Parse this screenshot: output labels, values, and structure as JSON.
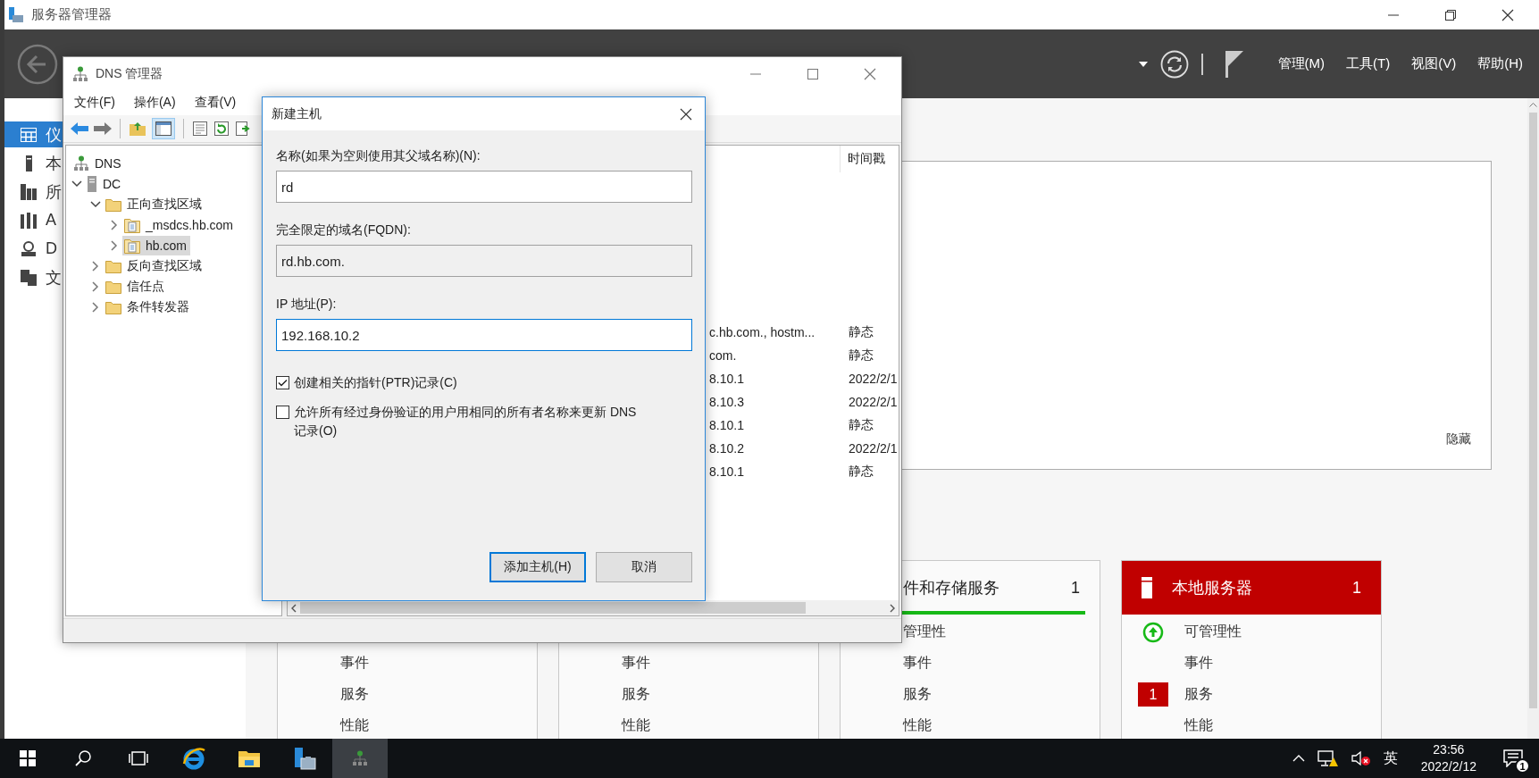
{
  "server_manager": {
    "title": "服务器管理器",
    "menu": [
      "管理(M)",
      "工具(T)",
      "视图(V)",
      "帮助(H)"
    ],
    "nav": [
      {
        "label": "仪",
        "kind": "dashboard",
        "selected": true
      },
      {
        "label": "本",
        "kind": "local",
        "selected": false
      },
      {
        "label": "所",
        "kind": "all",
        "selected": false
      },
      {
        "label": "A",
        "kind": "adds",
        "selected": false
      },
      {
        "label": "D",
        "kind": "dns",
        "selected": false
      },
      {
        "label": "文",
        "kind": "files",
        "selected": false
      }
    ],
    "panel": {
      "hide_link": "隐藏"
    },
    "tiles": [
      {
        "items": [
          {
            "label": "事件"
          },
          {
            "label": "服务"
          },
          {
            "label": "性能"
          }
        ]
      },
      {
        "items": [
          {
            "label": "事件"
          },
          {
            "label": "服务"
          },
          {
            "label": "性能"
          }
        ]
      },
      {
        "title": "件和存储服务",
        "count": "1",
        "alert": false,
        "items": [
          {
            "label": "管理性"
          },
          {
            "label": "事件"
          },
          {
            "label": "服务"
          },
          {
            "label": "性能"
          }
        ]
      },
      {
        "title": "本地服务器",
        "count": "1",
        "alert": true,
        "items": [
          {
            "label": "可管理性",
            "kind": "status_ok"
          },
          {
            "label": "事件"
          },
          {
            "label": "服务",
            "badge": "1"
          },
          {
            "label": "性能"
          }
        ]
      }
    ]
  },
  "dns_manager": {
    "title": "DNS 管理器",
    "menu": [
      "文件(F)",
      "操作(A)",
      "查看(V)"
    ],
    "tree": [
      {
        "label": "DNS",
        "kind": "dns_root",
        "selected": false,
        "children": [
          {
            "label": "DC",
            "kind": "server",
            "expanded": true,
            "selected": false,
            "children": [
              {
                "label": "正向查找区域",
                "kind": "folder",
                "expanded": true,
                "selected": false,
                "children": [
                  {
                    "label": "_msdcs.hb.com",
                    "kind": "zone",
                    "expanded": false,
                    "selected": false
                  },
                  {
                    "label": "hb.com",
                    "kind": "zone",
                    "expanded": false,
                    "selected": true
                  }
                ]
              },
              {
                "label": "反向查找区域",
                "kind": "folder",
                "expanded": false,
                "selected": false
              },
              {
                "label": "信任点",
                "kind": "folder",
                "expanded": false,
                "selected": false
              },
              {
                "label": "条件转发器",
                "kind": "folder",
                "expanded": false,
                "selected": false
              }
            ]
          }
        ]
      }
    ],
    "list": {
      "columns": [
        "时间戳"
      ],
      "rows": [
        {
          "column_1": "c.hb.com., hostm...",
          "timestamp": "静态"
        },
        {
          "column_1": "com.",
          "timestamp": "静态"
        },
        {
          "column_1": "8.10.1",
          "timestamp": "2022/2/1"
        },
        {
          "column_1": "8.10.3",
          "timestamp": "2022/2/1"
        },
        {
          "column_1": "8.10.1",
          "timestamp": "静态"
        },
        {
          "column_1": "8.10.2",
          "timestamp": "2022/2/1"
        },
        {
          "column_1": "8.10.1",
          "timestamp": "静态"
        }
      ]
    }
  },
  "new_host_dialog": {
    "title": "新建主机",
    "fields": [
      {
        "label": "名称(如果为空则使用其父域名称)(N):",
        "value": "rd",
        "disabled": false,
        "focused": false
      },
      {
        "label": "完全限定的域名(FQDN):",
        "value": "rd.hb.com.",
        "disabled": true,
        "focused": false
      },
      {
        "label": "IP 地址(P):",
        "value": "192.168.10.2",
        "disabled": false,
        "focused": true
      }
    ],
    "checkboxes": [
      {
        "label": "创建相关的指针(PTR)记录(C)",
        "checked": true
      },
      {
        "label": "允许所有经过身份验证的用户用相同的所有者名称来更新 DNS 记录(O)",
        "checked": false
      }
    ],
    "buttons": [
      {
        "label": "添加主机(H)",
        "default": true
      },
      {
        "label": "取消",
        "default": false
      }
    ]
  },
  "taskbar": {
    "apps": [
      {
        "kind": "start"
      },
      {
        "kind": "search"
      },
      {
        "kind": "task_view"
      },
      {
        "kind": "browser",
        "active": false
      },
      {
        "kind": "explorer",
        "active": false
      },
      {
        "kind": "server_manager",
        "active": false
      },
      {
        "kind": "dns",
        "active": true
      }
    ],
    "tray": {
      "ime": "英",
      "time": "23:56",
      "date": "2022/2/12",
      "notification_count": "1"
    }
  }
}
